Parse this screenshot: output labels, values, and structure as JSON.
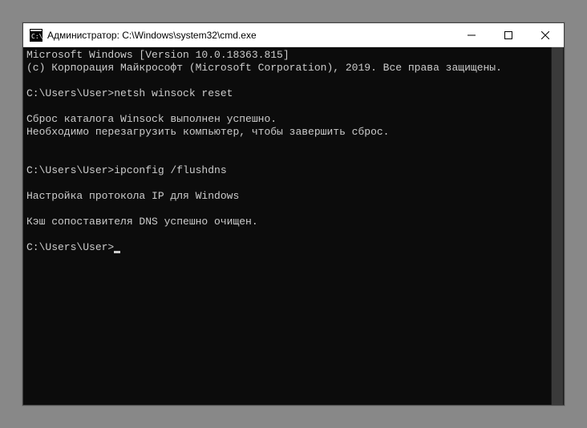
{
  "window": {
    "title": "Администратор: C:\\Windows\\system32\\cmd.exe"
  },
  "terminal": {
    "lines": [
      "Microsoft Windows [Version 10.0.18363.815]",
      "(c) Корпорация Майкрософт (Microsoft Corporation), 2019. Все права защищены.",
      "",
      "C:\\Users\\User>netsh winsock reset",
      "",
      "Сброс каталога Winsock выполнен успешно.",
      "Необходимо перезагрузить компьютер, чтобы завершить сброс.",
      "",
      "",
      "C:\\Users\\User>ipconfig /flushdns",
      "",
      "Настройка протокола IP для Windows",
      "",
      "Кэш сопоставителя DNS успешно очищен.",
      ""
    ],
    "current_prompt": "C:\\Users\\User>"
  }
}
